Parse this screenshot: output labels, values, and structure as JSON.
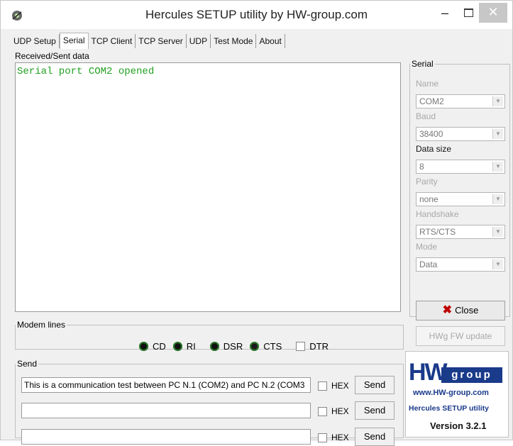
{
  "window": {
    "title": "Hercules SETUP utility by HW-group.com"
  },
  "tabs": [
    "UDP Setup",
    "Serial",
    "TCP Client",
    "TCP Server",
    "UDP",
    "Test Mode",
    "About"
  ],
  "received": {
    "label": "Received/Sent data",
    "text": "Serial port COM2 opened"
  },
  "serial": {
    "legend": "Serial",
    "name_label": "Name",
    "name_value": "COM2",
    "baud_label": "Baud",
    "baud_value": "38400",
    "datasize_label": "Data size",
    "datasize_value": "8",
    "parity_label": "Parity",
    "parity_value": "none",
    "handshake_label": "Handshake",
    "handshake_value": "RTS/CTS",
    "mode_label": "Mode",
    "mode_value": "Data"
  },
  "buttons": {
    "close": "Close",
    "fw_update": "HWg FW update",
    "send": "Send"
  },
  "modem": {
    "legend": "Modem lines",
    "cd": "CD",
    "ri": "RI",
    "dsr": "DSR",
    "cts": "CTS",
    "dtr": "DTR"
  },
  "send": {
    "legend": "Send",
    "hex_label": "HEX",
    "line1": "This is a communication test between PC N.1  (COM2)  and PC N.2 (COM3",
    "line2": "",
    "line3": ""
  },
  "logo": {
    "mark": "HW",
    "word": "group",
    "url": "www.HW-group.com",
    "name": "Hercules SETUP utility",
    "version": "Version  3.2.1"
  },
  "colors": {
    "received_text": "#20a020",
    "brand": "#1a3a8a",
    "close_x": "#c00000"
  },
  "icons": {
    "app": "hercules-app-icon",
    "close_button": "red-x-icon"
  }
}
